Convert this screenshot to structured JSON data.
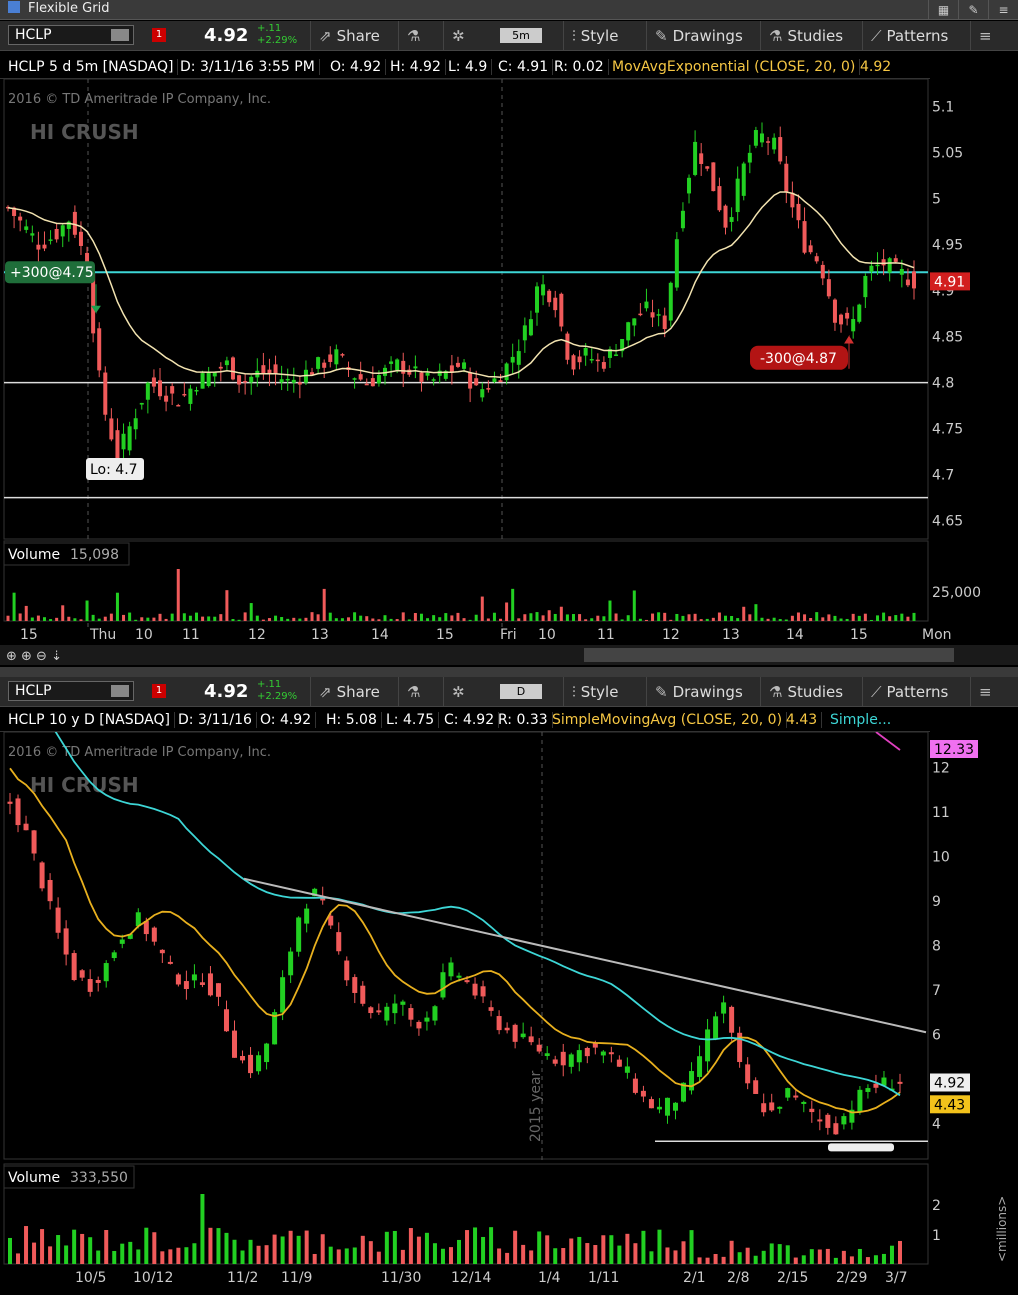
{
  "window": {
    "title": "Flexible Grid"
  },
  "colors": {
    "up": "#22d022",
    "down": "#f05a5a",
    "ema": "#f2e3b0",
    "sma20": "#e8b01e",
    "sma50": "#3dd6d6",
    "sma200": "#e040c0",
    "trend": "#bbbbbb",
    "cyan_line": "#3dd6d6"
  },
  "toolbar": {
    "symbol": "HCLP",
    "alert_count": "1",
    "last": "4.92",
    "change": "+.11",
    "change_pct": "+2.29%",
    "share": "Share",
    "style": "Style",
    "drawings": "Drawings",
    "studies": "Studies",
    "patterns": "Patterns"
  },
  "top": {
    "timeframe": "5m",
    "info": {
      "title": "HCLP 5 d 5m [NASDAQ]",
      "date": "D: 3/11/16 3:55 PM",
      "open": "O: 4.92",
      "high": "H: 4.92",
      "low": "L: 4.9",
      "close": "C: 4.91",
      "range": "R: 0.02",
      "study": "MovAvgExponential (CLOSE, 20, 0)",
      "study_val": "4.92"
    },
    "copyright": "2016 © TD Ameritrade IP Company, Inc.",
    "logo": "HI CRUSH",
    "buy_label": "+300@4.75",
    "sell_label": "-300@4.87",
    "low_label": "Lo: 4.7",
    "price_badge": "4.91",
    "volume_label": "Volume",
    "volume_value": "15,098",
    "volume_tick": "25,000",
    "x_labels": [
      "15",
      "Thu",
      "10",
      "11",
      "12",
      "13",
      "14",
      "15",
      "Fri",
      "10",
      "11",
      "12",
      "13",
      "14",
      "15",
      "Mon"
    ]
  },
  "bottom": {
    "timeframe": "D",
    "info": {
      "title": "HCLP 10 y D [NASDAQ]",
      "date": "D: 3/11/16",
      "open": "O: 4.92",
      "high": "H: 5.08",
      "low": "L: 4.75",
      "close": "C: 4.92",
      "range": "R: 0.33",
      "study": "SimpleMovingAvg (CLOSE, 20, 0)",
      "study_val": "4.43",
      "study2": "Simple..."
    },
    "copyright": "2016 © TD Ameritrade IP Company, Inc.",
    "logo": "HI CRUSH",
    "year_label": "2015 year",
    "badge_top": "12.33",
    "badge_price": "4.92",
    "badge_sma": "4.43",
    "volume_label": "Volume",
    "volume_value": "333,550",
    "volume_unit": "<millions>",
    "volume_ticks": [
      "2",
      "1"
    ],
    "x_labels": [
      "10/5",
      "10/12",
      "11/2",
      "11/9",
      "11/30",
      "12/14",
      "1/4",
      "1/11",
      "2/1",
      "2/8",
      "2/15",
      "2/29",
      "3/7"
    ]
  },
  "chart_data": [
    {
      "type": "candlestick",
      "title": "HCLP 5 d 5m [NASDAQ]",
      "ylim": [
        4.63,
        5.13
      ],
      "y_ticks": [
        "5.1",
        "5.05",
        "5",
        "4.95",
        "4.9",
        "4.85",
        "4.8",
        "4.75",
        "4.7",
        "4.65"
      ],
      "reference_lines": [
        4.92,
        4.8,
        4.675
      ],
      "series": [
        {
          "name": "MovAvgExponential (CLOSE, 20, 0)",
          "last": 4.92
        }
      ],
      "close_path": [
        4.99,
        4.97,
        4.95,
        4.96,
        4.98,
        4.93,
        4.78,
        4.72,
        4.76,
        4.8,
        4.79,
        4.78,
        4.8,
        4.81,
        4.82,
        4.8,
        4.81,
        4.81,
        4.8,
        4.81,
        4.82,
        4.83,
        4.81,
        4.8,
        4.81,
        4.82,
        4.81,
        4.8,
        4.81,
        4.82,
        4.79,
        4.8,
        4.82,
        4.85,
        4.91,
        4.89,
        4.82,
        4.83,
        4.82,
        4.84,
        4.87,
        4.88,
        4.86,
        4.98,
        5.06,
        5.02,
        4.97,
        5.03,
        5.07,
        5.06,
        5.0,
        4.95,
        4.93,
        4.87,
        4.86,
        4.92,
        4.93,
        4.92,
        4.91
      ]
    },
    {
      "type": "candlestick",
      "title": "HCLP 10 y D [NASDAQ]",
      "ylim": [
        3.2,
        12.8
      ],
      "y_ticks": [
        "12",
        "11",
        "10",
        "9",
        "8",
        "7",
        "6",
        "5",
        "4"
      ],
      "series": [
        {
          "name": "SimpleMovingAvg (CLOSE, 20, 0)",
          "last": 4.43
        },
        {
          "name": "Simple...",
          "last": 4.92
        }
      ],
      "close_path": [
        11.2,
        10.5,
        9.4,
        8.2,
        7.3,
        7.1,
        7.6,
        8.3,
        8.6,
        8.0,
        7.4,
        7.1,
        7.3,
        6.6,
        5.5,
        5.2,
        5.9,
        7.4,
        8.9,
        9.2,
        8.1,
        7.2,
        6.6,
        6.4,
        6.8,
        6.2,
        6.5,
        7.5,
        7.3,
        6.8,
        6.3,
        6.0,
        5.8,
        5.6,
        5.4,
        5.6,
        5.7,
        5.5,
        5.2,
        4.6,
        4.3,
        4.5,
        4.9,
        5.9,
        6.8,
        5.3,
        4.6,
        4.2,
        4.7,
        4.4,
        4.1,
        3.9,
        4.4,
        4.8,
        4.9,
        4.95
      ]
    }
  ]
}
